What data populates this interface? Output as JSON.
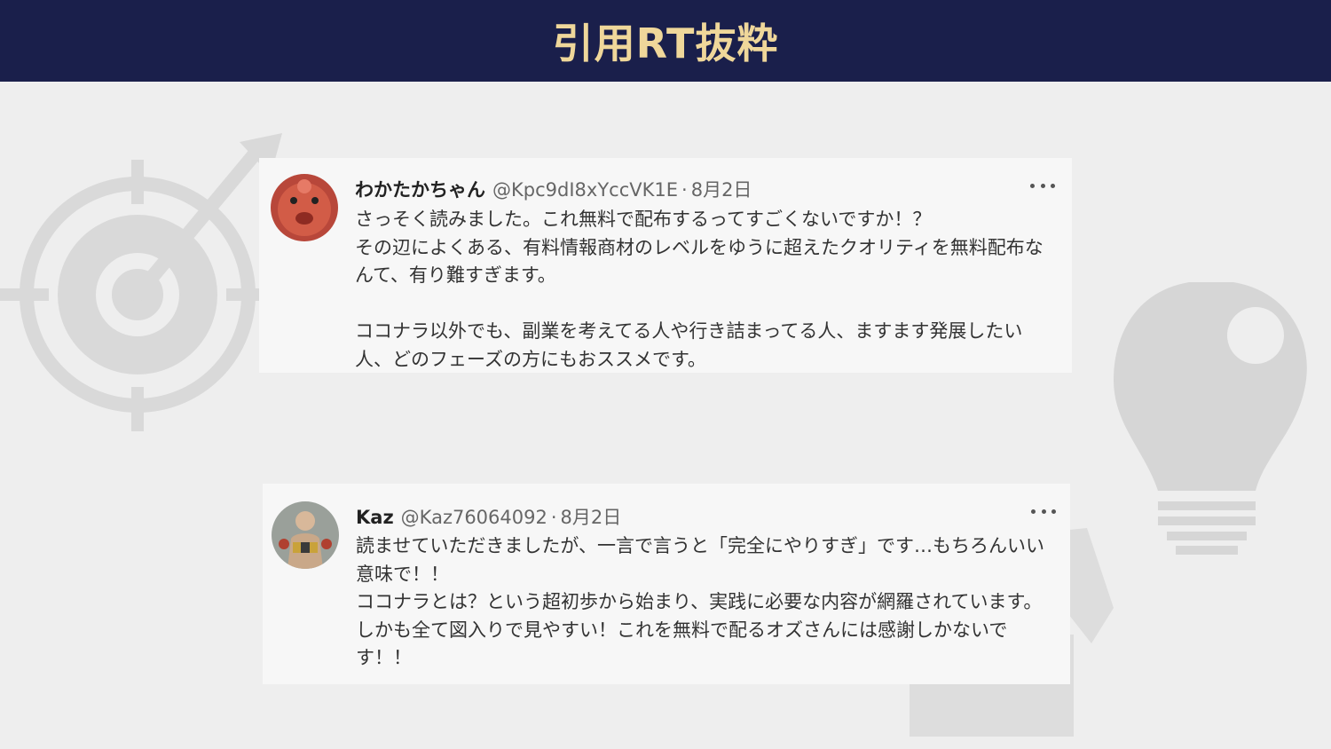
{
  "header": {
    "title": "引用RT抜粋"
  },
  "decorations": {
    "left_icon": "target-arrow-icon",
    "right_icon": "lightbulb-puzzle-icon",
    "bottom_icon": "puzzle-piece-icon",
    "icon_color": "#d8d8d8"
  },
  "tweets": [
    {
      "name": "わかたかちゃん",
      "handle": "@Kpc9dI8xYccVK1E",
      "separator": "·",
      "date": "8月2日",
      "body": "さっそく読みました。これ無料で配布するってすごくないですか！？\nその辺によくある、有料情報商材のレベルをゆうに超えたクオリティを無料配布なんて、有り難すぎます。\n\nココナラ以外でも、副業を考えてる人や行き詰まってる人、ますます発展したい人、どのフェーズの方にもおススメです。",
      "avatar_icon": "red-mascot-avatar",
      "more_icon": "more-dots-icon"
    },
    {
      "name": "Kaz",
      "handle": "@Kaz76064092",
      "separator": "·",
      "date": "8月2日",
      "body": "読ませていただきましたが、一言で言うと「完全にやりすぎ」です…もちろんいい意味で！！\nココナラとは？という超初歩から始まり、実践に必要な内容が網羅されています。しかも全て図入りで見やすい！これを無料で配るオズさんには感謝しかないです！！",
      "avatar_icon": "wrestler-photo-avatar",
      "more_icon": "more-dots-icon"
    }
  ]
}
